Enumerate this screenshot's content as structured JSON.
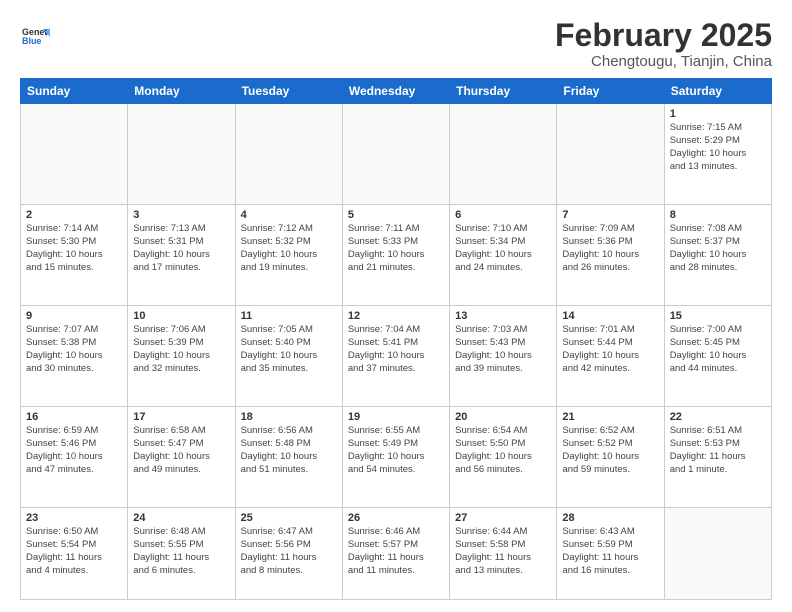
{
  "header": {
    "logo_line1": "General",
    "logo_line2": "Blue",
    "month_title": "February 2025",
    "location": "Chengtougu, Tianjin, China"
  },
  "days_of_week": [
    "Sunday",
    "Monday",
    "Tuesday",
    "Wednesday",
    "Thursday",
    "Friday",
    "Saturday"
  ],
  "weeks": [
    [
      {
        "day": "",
        "info": ""
      },
      {
        "day": "",
        "info": ""
      },
      {
        "day": "",
        "info": ""
      },
      {
        "day": "",
        "info": ""
      },
      {
        "day": "",
        "info": ""
      },
      {
        "day": "",
        "info": ""
      },
      {
        "day": "1",
        "info": "Sunrise: 7:15 AM\nSunset: 5:29 PM\nDaylight: 10 hours\nand 13 minutes."
      }
    ],
    [
      {
        "day": "2",
        "info": "Sunrise: 7:14 AM\nSunset: 5:30 PM\nDaylight: 10 hours\nand 15 minutes."
      },
      {
        "day": "3",
        "info": "Sunrise: 7:13 AM\nSunset: 5:31 PM\nDaylight: 10 hours\nand 17 minutes."
      },
      {
        "day": "4",
        "info": "Sunrise: 7:12 AM\nSunset: 5:32 PM\nDaylight: 10 hours\nand 19 minutes."
      },
      {
        "day": "5",
        "info": "Sunrise: 7:11 AM\nSunset: 5:33 PM\nDaylight: 10 hours\nand 21 minutes."
      },
      {
        "day": "6",
        "info": "Sunrise: 7:10 AM\nSunset: 5:34 PM\nDaylight: 10 hours\nand 24 minutes."
      },
      {
        "day": "7",
        "info": "Sunrise: 7:09 AM\nSunset: 5:36 PM\nDaylight: 10 hours\nand 26 minutes."
      },
      {
        "day": "8",
        "info": "Sunrise: 7:08 AM\nSunset: 5:37 PM\nDaylight: 10 hours\nand 28 minutes."
      }
    ],
    [
      {
        "day": "9",
        "info": "Sunrise: 7:07 AM\nSunset: 5:38 PM\nDaylight: 10 hours\nand 30 minutes."
      },
      {
        "day": "10",
        "info": "Sunrise: 7:06 AM\nSunset: 5:39 PM\nDaylight: 10 hours\nand 32 minutes."
      },
      {
        "day": "11",
        "info": "Sunrise: 7:05 AM\nSunset: 5:40 PM\nDaylight: 10 hours\nand 35 minutes."
      },
      {
        "day": "12",
        "info": "Sunrise: 7:04 AM\nSunset: 5:41 PM\nDaylight: 10 hours\nand 37 minutes."
      },
      {
        "day": "13",
        "info": "Sunrise: 7:03 AM\nSunset: 5:43 PM\nDaylight: 10 hours\nand 39 minutes."
      },
      {
        "day": "14",
        "info": "Sunrise: 7:01 AM\nSunset: 5:44 PM\nDaylight: 10 hours\nand 42 minutes."
      },
      {
        "day": "15",
        "info": "Sunrise: 7:00 AM\nSunset: 5:45 PM\nDaylight: 10 hours\nand 44 minutes."
      }
    ],
    [
      {
        "day": "16",
        "info": "Sunrise: 6:59 AM\nSunset: 5:46 PM\nDaylight: 10 hours\nand 47 minutes."
      },
      {
        "day": "17",
        "info": "Sunrise: 6:58 AM\nSunset: 5:47 PM\nDaylight: 10 hours\nand 49 minutes."
      },
      {
        "day": "18",
        "info": "Sunrise: 6:56 AM\nSunset: 5:48 PM\nDaylight: 10 hours\nand 51 minutes."
      },
      {
        "day": "19",
        "info": "Sunrise: 6:55 AM\nSunset: 5:49 PM\nDaylight: 10 hours\nand 54 minutes."
      },
      {
        "day": "20",
        "info": "Sunrise: 6:54 AM\nSunset: 5:50 PM\nDaylight: 10 hours\nand 56 minutes."
      },
      {
        "day": "21",
        "info": "Sunrise: 6:52 AM\nSunset: 5:52 PM\nDaylight: 10 hours\nand 59 minutes."
      },
      {
        "day": "22",
        "info": "Sunrise: 6:51 AM\nSunset: 5:53 PM\nDaylight: 11 hours\nand 1 minute."
      }
    ],
    [
      {
        "day": "23",
        "info": "Sunrise: 6:50 AM\nSunset: 5:54 PM\nDaylight: 11 hours\nand 4 minutes."
      },
      {
        "day": "24",
        "info": "Sunrise: 6:48 AM\nSunset: 5:55 PM\nDaylight: 11 hours\nand 6 minutes."
      },
      {
        "day": "25",
        "info": "Sunrise: 6:47 AM\nSunset: 5:56 PM\nDaylight: 11 hours\nand 8 minutes."
      },
      {
        "day": "26",
        "info": "Sunrise: 6:46 AM\nSunset: 5:57 PM\nDaylight: 11 hours\nand 11 minutes."
      },
      {
        "day": "27",
        "info": "Sunrise: 6:44 AM\nSunset: 5:58 PM\nDaylight: 11 hours\nand 13 minutes."
      },
      {
        "day": "28",
        "info": "Sunrise: 6:43 AM\nSunset: 5:59 PM\nDaylight: 11 hours\nand 16 minutes."
      },
      {
        "day": "",
        "info": ""
      }
    ]
  ]
}
